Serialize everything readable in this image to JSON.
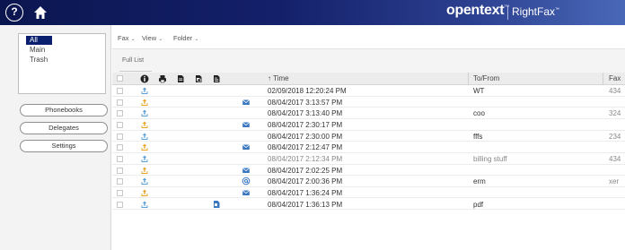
{
  "topbar": {
    "help_label": "?",
    "brand": "opentext",
    "brand_tm": "™",
    "product": "RightFax",
    "product_tm": "™",
    "colors": {
      "bar_dark": "#0b1650",
      "bar_light": "#4a68b8"
    }
  },
  "sidebar": {
    "folders": [
      "All",
      "Main",
      "Trash"
    ],
    "buttons": {
      "phonebooks": "Phonebooks",
      "delegates": "Delegates",
      "settings": "Settings"
    }
  },
  "toolbar": {
    "fax_menu": "Fax",
    "view_menu": "View",
    "folder_menu": "Folder",
    "caret": "⌄"
  },
  "tabs": {
    "full_list": "Full List"
  },
  "grid": {
    "headers": {
      "time": "↑ Time",
      "tofrom": "To/From",
      "fax": "Fax"
    },
    "header_icons": [
      "info-icon",
      "printer-icon",
      "document-icon",
      "attachment-icon",
      "cover-page-icon"
    ],
    "rows": [
      {
        "status": "sent-ok",
        "mail": "",
        "cover": "",
        "time": "02/09/2018 12:20:24 PM",
        "tofrom": "WT",
        "fax": "434"
      },
      {
        "status": "warning",
        "mail": "envelope",
        "cover": "",
        "time": "08/04/2017 3:13:57 PM",
        "tofrom": "",
        "fax": ""
      },
      {
        "status": "sent-ok",
        "mail": "",
        "cover": "",
        "time": "08/04/2017 3:13:40 PM",
        "tofrom": "coo",
        "fax": "324"
      },
      {
        "status": "warning",
        "mail": "envelope",
        "cover": "",
        "time": "08/04/2017 2:30:17 PM",
        "tofrom": "",
        "fax": ""
      },
      {
        "status": "sent-ok",
        "mail": "",
        "cover": "",
        "time": "08/04/2017 2:30:00 PM",
        "tofrom": "fffs",
        "fax": "234"
      },
      {
        "status": "warning",
        "mail": "envelope",
        "cover": "",
        "time": "08/04/2017 2:12:47 PM",
        "tofrom": "",
        "fax": ""
      },
      {
        "status": "sent-ok",
        "mail": "",
        "cover": "",
        "time": "08/04/2017 2:12:34 PM",
        "tofrom": "billing stuff",
        "fax": "434",
        "muted": true
      },
      {
        "status": "warning",
        "mail": "envelope",
        "cover": "",
        "time": "08/04/2017 2:02:25 PM",
        "tofrom": "",
        "fax": ""
      },
      {
        "status": "sent-ok",
        "mail": "at-sign",
        "cover": "",
        "time": "08/04/2017 2:00:36 PM",
        "tofrom": "erm",
        "fax": "xer"
      },
      {
        "status": "warning",
        "mail": "envelope",
        "cover": "",
        "time": "08/04/2017 1:36:24 PM",
        "tofrom": "",
        "fax": ""
      },
      {
        "status": "sent-ok",
        "mail": "",
        "cover": "attachment",
        "time": "08/04/2017 1:36:13 PM",
        "tofrom": "pdf",
        "fax": ""
      }
    ]
  }
}
